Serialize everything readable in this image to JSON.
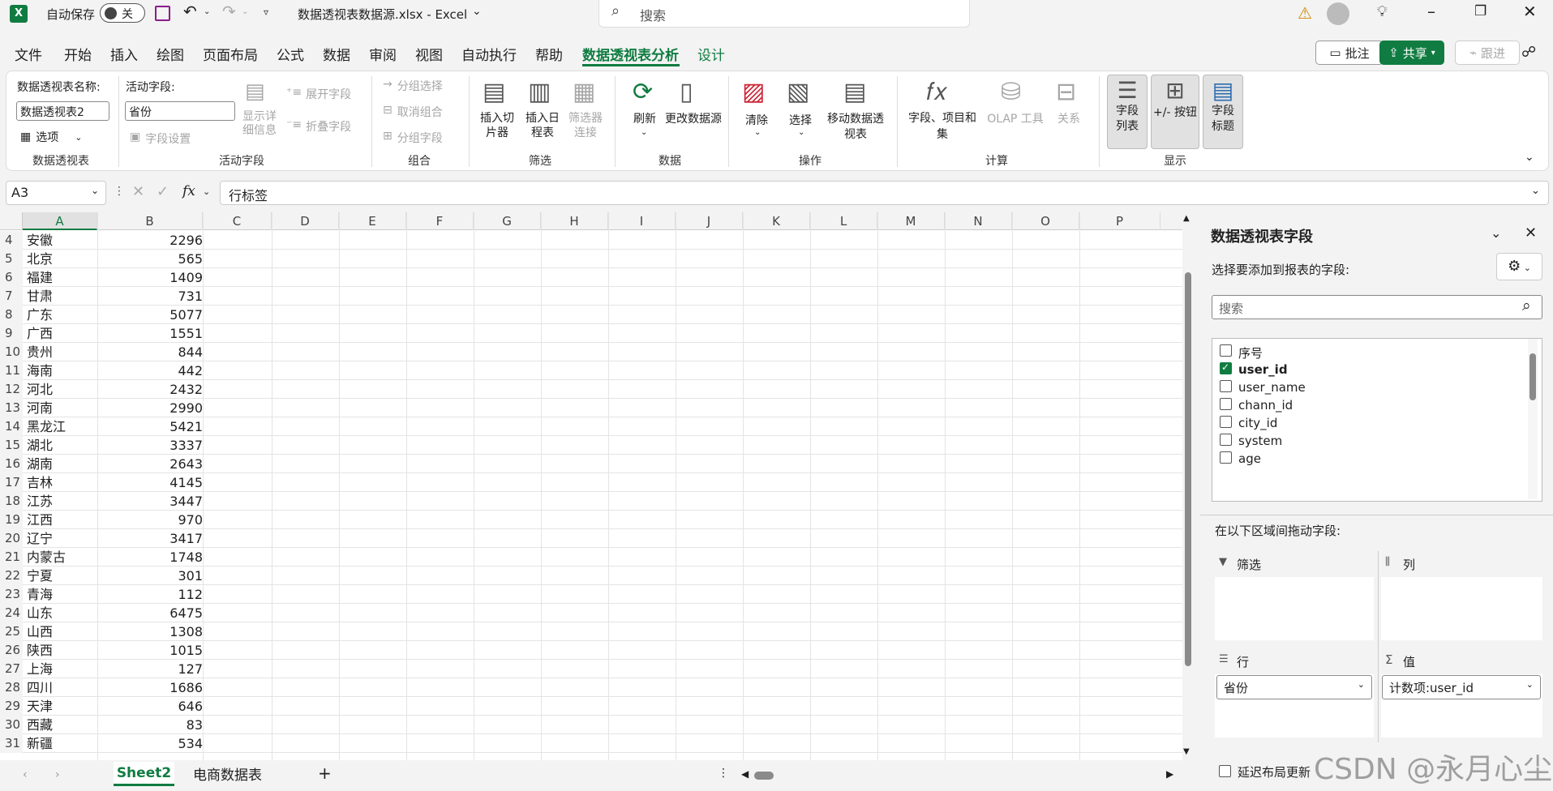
{
  "titlebar": {
    "autosave_label": "自动保存",
    "autosave_state": "关",
    "file_title": "数据透视表数据源.xlsx  -  Excel",
    "search_placeholder": "搜索"
  },
  "menu": {
    "items": [
      "文件",
      "开始",
      "插入",
      "绘图",
      "页面布局",
      "公式",
      "数据",
      "审阅",
      "视图",
      "自动执行",
      "帮助",
      "数据透视表分析",
      "设计"
    ],
    "active": "数据透视表分析",
    "comment_label": "批注",
    "share_label": "共享",
    "catchup_label": "跟进"
  },
  "ribbon": {
    "pivot_name_label": "数据透视表名称:",
    "pivot_name_value": "数据透视表2",
    "options_label": "选项",
    "group_pivot": "数据透视表",
    "active_field_label": "活动字段:",
    "active_field_value": "省份",
    "field_settings": "字段设置",
    "drill_down": "显示详细信息",
    "expand_field": "展开字段",
    "collapse_field": "折叠字段",
    "group_active": "活动字段",
    "group_selection": "分组选择",
    "ungroup": "取消组合",
    "group_field": "分组字段",
    "group_group": "组合",
    "insert_slicer": "插入切片器",
    "insert_timeline": "插入日程表",
    "filter_connections": "筛选器连接",
    "group_filter": "筛选",
    "refresh": "刷新",
    "change_source": "更改数据源",
    "group_data": "数据",
    "clear": "清除",
    "select": "选择",
    "move_pivot": "移动数据透视表",
    "group_actions": "操作",
    "fields_items_sets": "字段、项目和集",
    "olap_tools": "OLAP 工具",
    "relationships": "关系",
    "group_calc": "计算",
    "field_list": "字段列表",
    "buttons": "+/- 按钮",
    "field_headers": "字段标题",
    "group_show": "显示"
  },
  "formula_bar": {
    "name_box": "A3",
    "fx": "fx",
    "content": "行标签"
  },
  "columns": [
    "A",
    "B",
    "C",
    "D",
    "E",
    "F",
    "G",
    "H",
    "I",
    "J",
    "K",
    "L",
    "M",
    "N",
    "O",
    "P"
  ],
  "rows": [
    {
      "n": "4",
      "a": "安徽",
      "b": "2296"
    },
    {
      "n": "5",
      "a": "北京",
      "b": "565"
    },
    {
      "n": "6",
      "a": "福建",
      "b": "1409"
    },
    {
      "n": "7",
      "a": "甘肃",
      "b": "731"
    },
    {
      "n": "8",
      "a": "广东",
      "b": "5077"
    },
    {
      "n": "9",
      "a": "广西",
      "b": "1551"
    },
    {
      "n": "10",
      "a": "贵州",
      "b": "844"
    },
    {
      "n": "11",
      "a": "海南",
      "b": "442"
    },
    {
      "n": "12",
      "a": "河北",
      "b": "2432"
    },
    {
      "n": "13",
      "a": "河南",
      "b": "2990"
    },
    {
      "n": "14",
      "a": "黑龙江",
      "b": "5421"
    },
    {
      "n": "15",
      "a": "湖北",
      "b": "3337"
    },
    {
      "n": "16",
      "a": "湖南",
      "b": "2643"
    },
    {
      "n": "17",
      "a": "吉林",
      "b": "4145"
    },
    {
      "n": "18",
      "a": "江苏",
      "b": "3447"
    },
    {
      "n": "19",
      "a": "江西",
      "b": "970"
    },
    {
      "n": "20",
      "a": "辽宁",
      "b": "3417"
    },
    {
      "n": "21",
      "a": "内蒙古",
      "b": "1748"
    },
    {
      "n": "22",
      "a": "宁夏",
      "b": "301"
    },
    {
      "n": "23",
      "a": "青海",
      "b": "112"
    },
    {
      "n": "24",
      "a": "山东",
      "b": "6475"
    },
    {
      "n": "25",
      "a": "山西",
      "b": "1308"
    },
    {
      "n": "26",
      "a": "陕西",
      "b": "1015"
    },
    {
      "n": "27",
      "a": "上海",
      "b": "127"
    },
    {
      "n": "28",
      "a": "四川",
      "b": "1686"
    },
    {
      "n": "29",
      "a": "天津",
      "b": "646"
    },
    {
      "n": "30",
      "a": "西藏",
      "b": "83"
    },
    {
      "n": "31",
      "a": "新疆",
      "b": "534"
    }
  ],
  "sheet_tabs": [
    "Sheet2",
    "电商数据表"
  ],
  "pane": {
    "title": "数据透视表字段",
    "subtitle": "选择要添加到报表的字段:",
    "search_placeholder": "搜索",
    "fields": [
      {
        "name": "序号",
        "checked": false
      },
      {
        "name": "user_id",
        "checked": true
      },
      {
        "name": "user_name",
        "checked": false
      },
      {
        "name": "chann_id",
        "checked": false
      },
      {
        "name": "city_id",
        "checked": false
      },
      {
        "name": "system",
        "checked": false
      },
      {
        "name": "age",
        "checked": false
      }
    ],
    "drag_hint": "在以下区域间拖动字段:",
    "filters_label": "筛选",
    "columns_label": "列",
    "rows_label": "行",
    "values_label": "值",
    "rows_item": "省份",
    "values_item": "计数项:user_id",
    "defer_label": "延迟布局更新"
  },
  "watermark": "CSDN @永月心尘",
  "colors": {
    "accent": "#107c41"
  }
}
